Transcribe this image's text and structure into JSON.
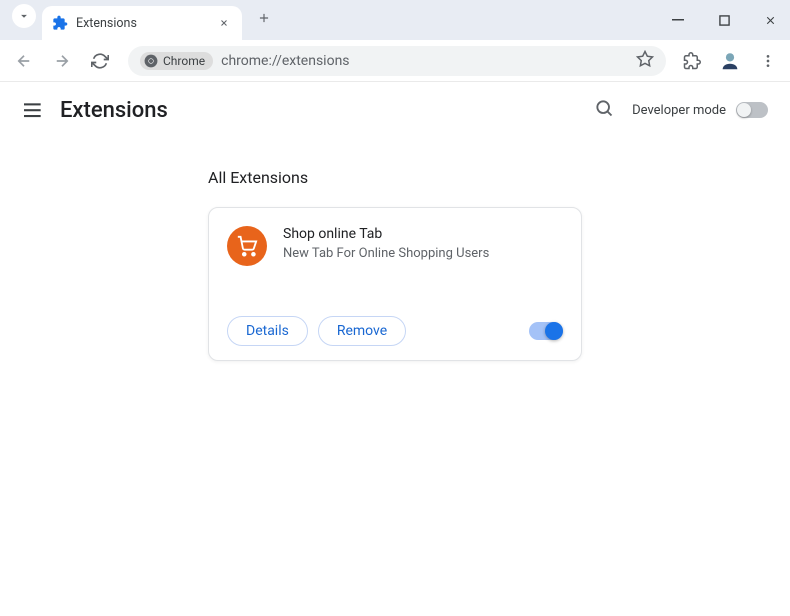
{
  "tab": {
    "title": "Extensions"
  },
  "address": {
    "badge": "Chrome",
    "url": "chrome://extensions"
  },
  "page": {
    "title": "Extensions",
    "devmode_label": "Developer mode",
    "section": "All Extensions"
  },
  "extension": {
    "name": "Shop online Tab",
    "description": "New Tab For Online Shopping Users",
    "details_label": "Details",
    "remove_label": "Remove"
  }
}
